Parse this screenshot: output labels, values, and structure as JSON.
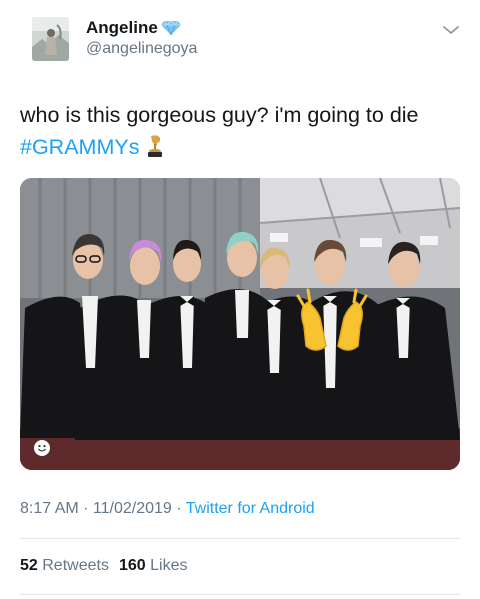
{
  "user": {
    "display_name": "Angeline",
    "handle": "@angelinegoya",
    "badge_icon": "blue-diamond-icon"
  },
  "tweet": {
    "text": "who is this gorgeous guy? i'm going to die",
    "hashtag": "#GRAMMYs",
    "hashtag_icon": "grammy-trophy-icon"
  },
  "media": {
    "type": "photo",
    "overlay_icon": "raised-hands-emoji",
    "corner_icon": "sticker-face-icon"
  },
  "meta": {
    "time": "8:17 AM",
    "sep1": " · ",
    "date": "11/02/2019",
    "sep2": " · ",
    "source": "Twitter for Android"
  },
  "stats": {
    "retweets_count": "52",
    "retweets_label": "Retweets",
    "likes_count": "160",
    "likes_label": "Likes"
  },
  "colors": {
    "link": "#1da1f2",
    "secondary_text": "#657786",
    "divider": "#e1e8ed"
  }
}
